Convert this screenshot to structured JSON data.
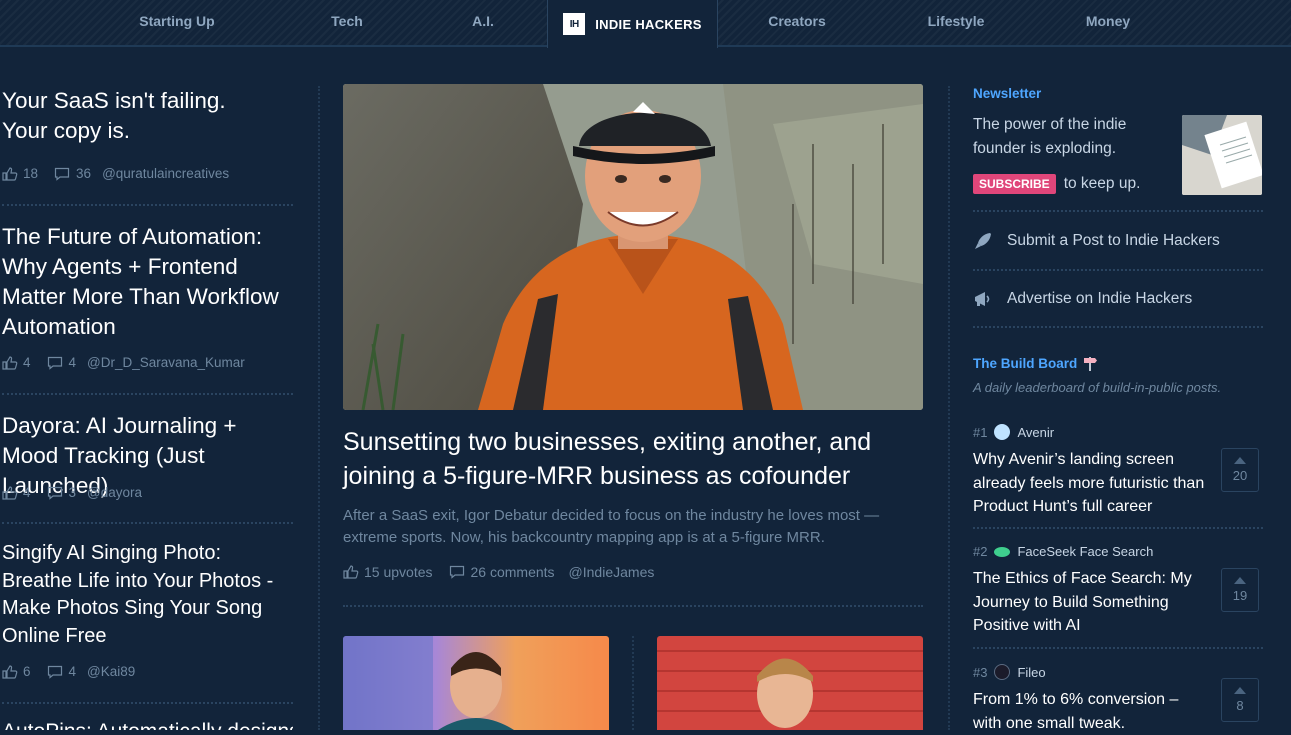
{
  "nav": {
    "items": [
      "Starting Up",
      "Tech",
      "A.I.",
      "Creators",
      "Lifestyle",
      "Money"
    ],
    "active": {
      "logo": "IH",
      "label": "INDIE HACKERS"
    }
  },
  "left_posts": [
    {
      "title": "Your SaaS isn't failing. Your copy is.",
      "upvotes": "18",
      "comments": "36",
      "author": "@quratulaincreatives"
    },
    {
      "title": "The Future of Automation: Why Agents + Frontend Matter More Than Workflow Automation",
      "upvotes": "4",
      "comments": "4",
      "author": "@Dr_D_Saravana_Kumar"
    },
    {
      "title": "Dayora: AI Journaling + Mood Tracking (Just Launched)",
      "upvotes": "4",
      "comments": "3",
      "author": "@dayora"
    },
    {
      "title": "Singify AI Singing Photo: Breathe Life into Your Photos - Make Photos Sing Your Song Online Free",
      "upvotes": "6",
      "comments": "4",
      "author": "@Kai89"
    },
    {
      "title": "AutoPins: Automatically designs"
    }
  ],
  "feature": {
    "title": "Sunsetting two businesses, exiting another, and joining a 5-figure-MRR business as cofounder",
    "description": "After a SaaS exit, Igor Debatur decided to focus on the industry he loves most — extreme sports. Now, his backcountry mapping app is at a 5-figure MRR.",
    "upvotes": "15 upvotes",
    "comments": "26 comments",
    "author": "@IndieJames"
  },
  "newsletter": {
    "label": "Newsletter",
    "text": "The power of the indie founder is exploding.",
    "subscribe": "SUBSCRIBE",
    "after": "to keep up."
  },
  "links": {
    "submit": "Submit a Post to Indie Hackers",
    "advertise": "Advertise on Indie Hackers"
  },
  "build_board": {
    "label": "The Build Board",
    "subtitle": "A daily leaderboard of build-in-public posts.",
    "items": [
      {
        "rank": "#1",
        "name": "Avenir",
        "title": "Why Avenir’s landing screen already feels more futuristic than Product Hunt’s full career",
        "votes": "20",
        "icon_color": "#bfe3ff"
      },
      {
        "rank": "#2",
        "name": "FaceSeek Face Search",
        "title": "The Ethics of Face Search: My Journey to Build Something Positive with AI",
        "votes": "19",
        "icon_color": "#3fcf8e"
      },
      {
        "rank": "#3",
        "name": "Fileo",
        "title": "From 1% to 6% conversion – with one small tweak.",
        "votes": "8",
        "icon_color": "#1b1b2a"
      }
    ]
  }
}
